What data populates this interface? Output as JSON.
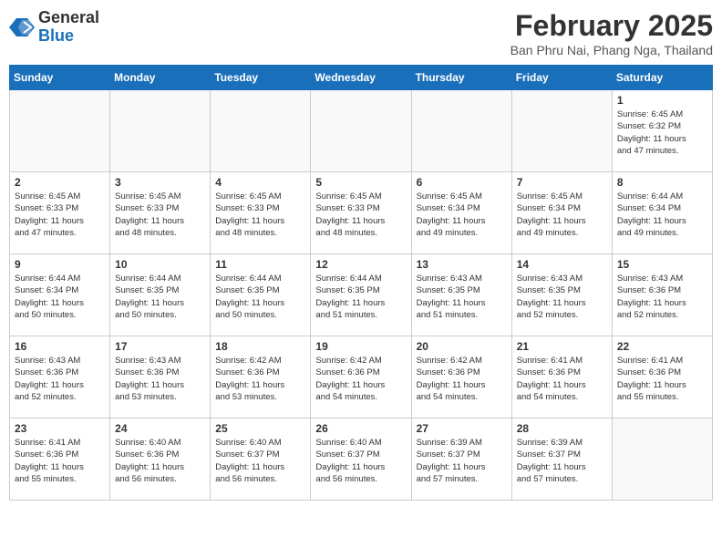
{
  "header": {
    "logo_general": "General",
    "logo_blue": "Blue",
    "month_title": "February 2025",
    "location": "Ban Phru Nai, Phang Nga, Thailand"
  },
  "weekdays": [
    "Sunday",
    "Monday",
    "Tuesday",
    "Wednesday",
    "Thursday",
    "Friday",
    "Saturday"
  ],
  "weeks": [
    [
      {
        "day": "",
        "info": ""
      },
      {
        "day": "",
        "info": ""
      },
      {
        "day": "",
        "info": ""
      },
      {
        "day": "",
        "info": ""
      },
      {
        "day": "",
        "info": ""
      },
      {
        "day": "",
        "info": ""
      },
      {
        "day": "1",
        "info": "Sunrise: 6:45 AM\nSunset: 6:32 PM\nDaylight: 11 hours\nand 47 minutes."
      }
    ],
    [
      {
        "day": "2",
        "info": "Sunrise: 6:45 AM\nSunset: 6:33 PM\nDaylight: 11 hours\nand 47 minutes."
      },
      {
        "day": "3",
        "info": "Sunrise: 6:45 AM\nSunset: 6:33 PM\nDaylight: 11 hours\nand 48 minutes."
      },
      {
        "day": "4",
        "info": "Sunrise: 6:45 AM\nSunset: 6:33 PM\nDaylight: 11 hours\nand 48 minutes."
      },
      {
        "day": "5",
        "info": "Sunrise: 6:45 AM\nSunset: 6:33 PM\nDaylight: 11 hours\nand 48 minutes."
      },
      {
        "day": "6",
        "info": "Sunrise: 6:45 AM\nSunset: 6:34 PM\nDaylight: 11 hours\nand 49 minutes."
      },
      {
        "day": "7",
        "info": "Sunrise: 6:45 AM\nSunset: 6:34 PM\nDaylight: 11 hours\nand 49 minutes."
      },
      {
        "day": "8",
        "info": "Sunrise: 6:44 AM\nSunset: 6:34 PM\nDaylight: 11 hours\nand 49 minutes."
      }
    ],
    [
      {
        "day": "9",
        "info": "Sunrise: 6:44 AM\nSunset: 6:34 PM\nDaylight: 11 hours\nand 50 minutes."
      },
      {
        "day": "10",
        "info": "Sunrise: 6:44 AM\nSunset: 6:35 PM\nDaylight: 11 hours\nand 50 minutes."
      },
      {
        "day": "11",
        "info": "Sunrise: 6:44 AM\nSunset: 6:35 PM\nDaylight: 11 hours\nand 50 minutes."
      },
      {
        "day": "12",
        "info": "Sunrise: 6:44 AM\nSunset: 6:35 PM\nDaylight: 11 hours\nand 51 minutes."
      },
      {
        "day": "13",
        "info": "Sunrise: 6:43 AM\nSunset: 6:35 PM\nDaylight: 11 hours\nand 51 minutes."
      },
      {
        "day": "14",
        "info": "Sunrise: 6:43 AM\nSunset: 6:35 PM\nDaylight: 11 hours\nand 52 minutes."
      },
      {
        "day": "15",
        "info": "Sunrise: 6:43 AM\nSunset: 6:36 PM\nDaylight: 11 hours\nand 52 minutes."
      }
    ],
    [
      {
        "day": "16",
        "info": "Sunrise: 6:43 AM\nSunset: 6:36 PM\nDaylight: 11 hours\nand 52 minutes."
      },
      {
        "day": "17",
        "info": "Sunrise: 6:43 AM\nSunset: 6:36 PM\nDaylight: 11 hours\nand 53 minutes."
      },
      {
        "day": "18",
        "info": "Sunrise: 6:42 AM\nSunset: 6:36 PM\nDaylight: 11 hours\nand 53 minutes."
      },
      {
        "day": "19",
        "info": "Sunrise: 6:42 AM\nSunset: 6:36 PM\nDaylight: 11 hours\nand 54 minutes."
      },
      {
        "day": "20",
        "info": "Sunrise: 6:42 AM\nSunset: 6:36 PM\nDaylight: 11 hours\nand 54 minutes."
      },
      {
        "day": "21",
        "info": "Sunrise: 6:41 AM\nSunset: 6:36 PM\nDaylight: 11 hours\nand 54 minutes."
      },
      {
        "day": "22",
        "info": "Sunrise: 6:41 AM\nSunset: 6:36 PM\nDaylight: 11 hours\nand 55 minutes."
      }
    ],
    [
      {
        "day": "23",
        "info": "Sunrise: 6:41 AM\nSunset: 6:36 PM\nDaylight: 11 hours\nand 55 minutes."
      },
      {
        "day": "24",
        "info": "Sunrise: 6:40 AM\nSunset: 6:36 PM\nDaylight: 11 hours\nand 56 minutes."
      },
      {
        "day": "25",
        "info": "Sunrise: 6:40 AM\nSunset: 6:37 PM\nDaylight: 11 hours\nand 56 minutes."
      },
      {
        "day": "26",
        "info": "Sunrise: 6:40 AM\nSunset: 6:37 PM\nDaylight: 11 hours\nand 56 minutes."
      },
      {
        "day": "27",
        "info": "Sunrise: 6:39 AM\nSunset: 6:37 PM\nDaylight: 11 hours\nand 57 minutes."
      },
      {
        "day": "28",
        "info": "Sunrise: 6:39 AM\nSunset: 6:37 PM\nDaylight: 11 hours\nand 57 minutes."
      },
      {
        "day": "",
        "info": ""
      }
    ]
  ]
}
